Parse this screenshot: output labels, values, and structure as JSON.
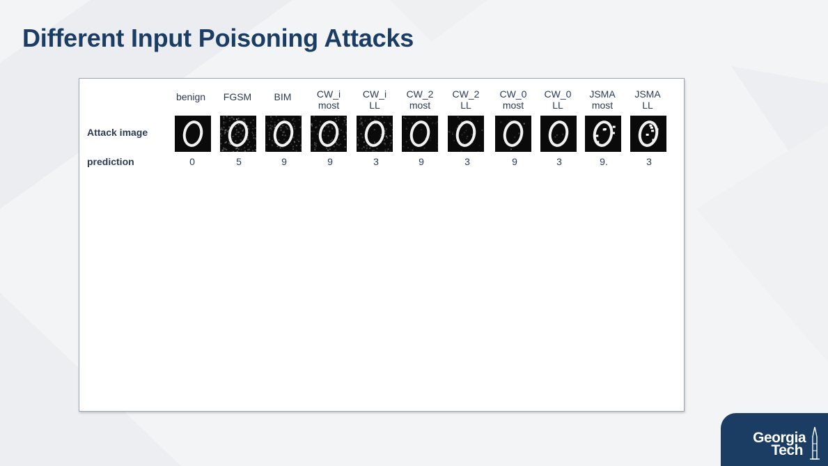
{
  "slide": {
    "title": "Different Input Poisoning Attacks"
  },
  "figure": {
    "row_labels": {
      "attack_image": "Attack image",
      "prediction": "prediction"
    },
    "columns": [
      {
        "line1": "benign",
        "line2": "",
        "prediction": "0",
        "noise": "none"
      },
      {
        "line1": "FGSM",
        "line2": "",
        "prediction": "5",
        "noise": "heavy"
      },
      {
        "line1": "BIM",
        "line2": "",
        "prediction": "9",
        "noise": "medium"
      },
      {
        "line1": "CW_i",
        "line2": "most",
        "prediction": "9",
        "noise": "medium"
      },
      {
        "line1": "CW_i",
        "line2": "LL",
        "prediction": "3",
        "noise": "medium"
      },
      {
        "line1": "CW_2",
        "line2": "most",
        "prediction": "9",
        "noise": "light"
      },
      {
        "line1": "CW_2",
        "line2": "LL",
        "prediction": "3",
        "noise": "light"
      },
      {
        "line1": "CW_0",
        "line2": "most",
        "prediction": "9",
        "noise": "sparse"
      },
      {
        "line1": "CW_0",
        "line2": "LL",
        "prediction": "3",
        "noise": "sparse"
      },
      {
        "line1": "JSMA",
        "line2": "most",
        "prediction": "9.",
        "noise": "blocky"
      },
      {
        "line1": "JSMA",
        "line2": "LL",
        "prediction": "3",
        "noise": "blocky"
      }
    ]
  },
  "logo": {
    "line1": "Georgia",
    "line2": "Tech"
  },
  "colors": {
    "title": "#1b3d64",
    "logo_bg": "#1b3d64",
    "text": "#2a3a55"
  }
}
